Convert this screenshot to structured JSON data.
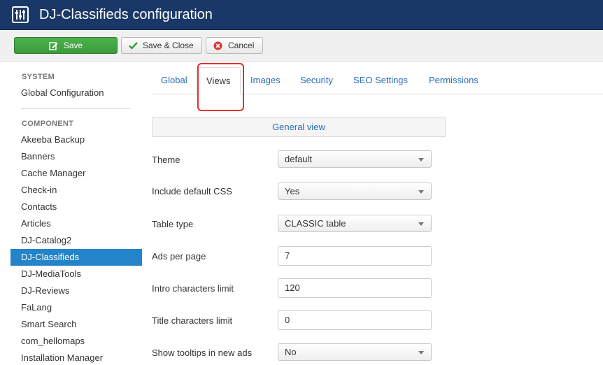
{
  "header": {
    "title": "DJ-Classifieds configuration",
    "icon": "equalizer-icon"
  },
  "toolbar": {
    "save_label": "Save",
    "save_close_label": "Save & Close",
    "cancel_label": "Cancel"
  },
  "sidebar": {
    "system_heading": "SYSTEM",
    "system_items": [
      {
        "label": "Global Configuration"
      }
    ],
    "component_heading": "COMPONENT",
    "component_items": [
      {
        "label": "Akeeba Backup"
      },
      {
        "label": "Banners"
      },
      {
        "label": "Cache Manager"
      },
      {
        "label": "Check-in"
      },
      {
        "label": "Contacts"
      },
      {
        "label": "Articles"
      },
      {
        "label": "DJ-Catalog2"
      },
      {
        "label": "DJ-Classifieds",
        "active": true
      },
      {
        "label": "DJ-MediaTools"
      },
      {
        "label": "DJ-Reviews"
      },
      {
        "label": "FaLang"
      },
      {
        "label": "Smart Search"
      },
      {
        "label": "com_hellomaps"
      },
      {
        "label": "Installation Manager"
      }
    ]
  },
  "tabs": [
    {
      "label": "Global"
    },
    {
      "label": "Views",
      "active": true
    },
    {
      "label": "Images"
    },
    {
      "label": "Security"
    },
    {
      "label": "SEO Settings"
    },
    {
      "label": "Permissions"
    }
  ],
  "section": {
    "title": "General view"
  },
  "form": {
    "theme": {
      "label": "Theme",
      "value": "default"
    },
    "include_css": {
      "label": "Include default CSS",
      "value": "Yes"
    },
    "table_type": {
      "label": "Table type",
      "value": "CLASSIC table"
    },
    "ads_per_page": {
      "label": "Ads per page",
      "value": "7"
    },
    "intro_limit": {
      "label": "Intro characters limit",
      "value": "120"
    },
    "title_limit": {
      "label": "Title characters limit",
      "value": "0"
    },
    "tooltips": {
      "label": "Show tooltips in new ads",
      "value": "No"
    }
  },
  "colors": {
    "header_bg": "#1a3867",
    "save_green": "#3b9a3b",
    "active_blue": "#2384c9",
    "link_blue": "#2a6db5",
    "highlight_red": "#e03030"
  }
}
